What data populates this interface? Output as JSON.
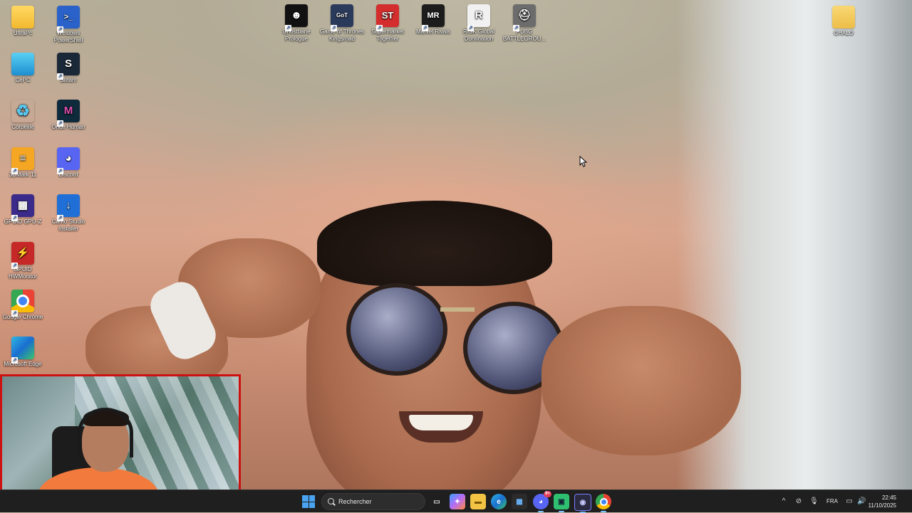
{
  "desktop": {
    "icons_left_col1": [
      {
        "label": "UltraPc",
        "icon": "folder-icon"
      },
      {
        "label": "CePC",
        "icon": "this-pc-icon"
      },
      {
        "label": "Corbeille",
        "icon": "recycle-bin-icon"
      },
      {
        "label": "3DMark 11",
        "icon": "3dmark-icon"
      },
      {
        "label": "GPUID GPU-Z",
        "icon": "gpuz-icon"
      },
      {
        "label": "GPUID HWMonitor",
        "icon": "hwmonitor-icon"
      },
      {
        "label": "Google Chrome",
        "icon": "chrome-icon"
      },
      {
        "label": "Microsoft Edge",
        "icon": "edge-icon"
      }
    ],
    "icons_left_col2": [
      {
        "label": "Windows PowerShell",
        "icon": "powershell-icon"
      },
      {
        "label": "Steam",
        "icon": "steam-icon"
      },
      {
        "label": "Once Human",
        "icon": "once-human-icon"
      },
      {
        "label": "Discord",
        "icon": "discord-icon"
      },
      {
        "label": "Camo Studio Installer",
        "icon": "camo-icon"
      }
    ],
    "icons_top": [
      {
        "label": "Ghostbane Prologue",
        "icon": "ghostbane-icon"
      },
      {
        "label": "Game of Thrones Kingsroad",
        "icon": "got-icon"
      },
      {
        "label": "Supermarket Together",
        "icon": "supermarket-icon"
      },
      {
        "label": "Marvel Rivals",
        "icon": "marvel-rivals-icon"
      },
      {
        "label": "RISK Global Domination",
        "icon": "risk-icon"
      },
      {
        "label": "PUBG BATTLEGROU...",
        "icon": "pubg-icon"
      }
    ],
    "icons_right": [
      {
        "label": "GHALO",
        "icon": "folder-icon"
      }
    ]
  },
  "icon_glyphs": {
    "powershell": ">_",
    "steam": "S",
    "once_human": "M",
    "mark": "≡",
    "discord": "◕",
    "gpuz": "▦",
    "camo": "↓",
    "hwm": "⚡",
    "ghostbane": "☻",
    "got": "GoT",
    "st": "ST",
    "mr": "MR",
    "risk": "R",
    "pubg": "⛑",
    "recycle": "♻",
    "shortcut": "↗"
  },
  "taskbar": {
    "search_placeholder": "Rechercher",
    "apps": [
      {
        "icon": "task-view-icon",
        "glyph": "▭"
      },
      {
        "icon": "copilot-icon",
        "glyph": "✦"
      },
      {
        "icon": "file-explorer-icon",
        "glyph": "▬"
      },
      {
        "icon": "edge-icon",
        "glyph": "e"
      },
      {
        "icon": "store-icon",
        "glyph": "▦"
      },
      {
        "icon": "discord-icon",
        "glyph": "◕",
        "badge": "9+"
      },
      {
        "icon": "xbox-app-icon",
        "glyph": "▣"
      },
      {
        "icon": "obs-icon",
        "glyph": "◉"
      },
      {
        "icon": "chrome-icon",
        "glyph": ""
      }
    ],
    "language": "FRA",
    "time": "22:45",
    "date": "11/10/2025",
    "tray_chevron": "^",
    "tray_icons": {
      "network": "⊘",
      "mic": "🎙",
      "display": "▭",
      "volume": "🔊"
    }
  },
  "colors": {
    "taskbar_bg": "#1f1f1f",
    "webcam_border": "#cc1111",
    "accent": "#4aa3f0"
  }
}
